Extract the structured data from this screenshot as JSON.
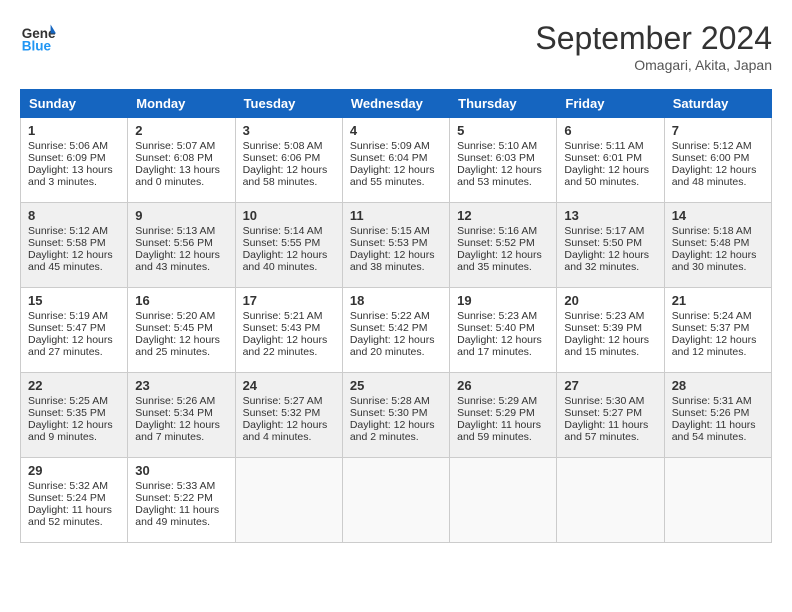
{
  "header": {
    "logo_line1": "General",
    "logo_line2": "Blue",
    "month": "September 2024",
    "location": "Omagari, Akita, Japan"
  },
  "weekdays": [
    "Sunday",
    "Monday",
    "Tuesday",
    "Wednesday",
    "Thursday",
    "Friday",
    "Saturday"
  ],
  "weeks": [
    [
      {
        "day": "1",
        "sunrise": "5:06 AM",
        "sunset": "6:09 PM",
        "daylight": "13 hours and 3 minutes."
      },
      {
        "day": "2",
        "sunrise": "5:07 AM",
        "sunset": "6:08 PM",
        "daylight": "13 hours and 0 minutes."
      },
      {
        "day": "3",
        "sunrise": "5:08 AM",
        "sunset": "6:06 PM",
        "daylight": "12 hours and 58 minutes."
      },
      {
        "day": "4",
        "sunrise": "5:09 AM",
        "sunset": "6:04 PM",
        "daylight": "12 hours and 55 minutes."
      },
      {
        "day": "5",
        "sunrise": "5:10 AM",
        "sunset": "6:03 PM",
        "daylight": "12 hours and 53 minutes."
      },
      {
        "day": "6",
        "sunrise": "5:11 AM",
        "sunset": "6:01 PM",
        "daylight": "12 hours and 50 minutes."
      },
      {
        "day": "7",
        "sunrise": "5:12 AM",
        "sunset": "6:00 PM",
        "daylight": "12 hours and 48 minutes."
      }
    ],
    [
      {
        "day": "8",
        "sunrise": "5:12 AM",
        "sunset": "5:58 PM",
        "daylight": "12 hours and 45 minutes."
      },
      {
        "day": "9",
        "sunrise": "5:13 AM",
        "sunset": "5:56 PM",
        "daylight": "12 hours and 43 minutes."
      },
      {
        "day": "10",
        "sunrise": "5:14 AM",
        "sunset": "5:55 PM",
        "daylight": "12 hours and 40 minutes."
      },
      {
        "day": "11",
        "sunrise": "5:15 AM",
        "sunset": "5:53 PM",
        "daylight": "12 hours and 38 minutes."
      },
      {
        "day": "12",
        "sunrise": "5:16 AM",
        "sunset": "5:52 PM",
        "daylight": "12 hours and 35 minutes."
      },
      {
        "day": "13",
        "sunrise": "5:17 AM",
        "sunset": "5:50 PM",
        "daylight": "12 hours and 32 minutes."
      },
      {
        "day": "14",
        "sunrise": "5:18 AM",
        "sunset": "5:48 PM",
        "daylight": "12 hours and 30 minutes."
      }
    ],
    [
      {
        "day": "15",
        "sunrise": "5:19 AM",
        "sunset": "5:47 PM",
        "daylight": "12 hours and 27 minutes."
      },
      {
        "day": "16",
        "sunrise": "5:20 AM",
        "sunset": "5:45 PM",
        "daylight": "12 hours and 25 minutes."
      },
      {
        "day": "17",
        "sunrise": "5:21 AM",
        "sunset": "5:43 PM",
        "daylight": "12 hours and 22 minutes."
      },
      {
        "day": "18",
        "sunrise": "5:22 AM",
        "sunset": "5:42 PM",
        "daylight": "12 hours and 20 minutes."
      },
      {
        "day": "19",
        "sunrise": "5:23 AM",
        "sunset": "5:40 PM",
        "daylight": "12 hours and 17 minutes."
      },
      {
        "day": "20",
        "sunrise": "5:23 AM",
        "sunset": "5:39 PM",
        "daylight": "12 hours and 15 minutes."
      },
      {
        "day": "21",
        "sunrise": "5:24 AM",
        "sunset": "5:37 PM",
        "daylight": "12 hours and 12 minutes."
      }
    ],
    [
      {
        "day": "22",
        "sunrise": "5:25 AM",
        "sunset": "5:35 PM",
        "daylight": "12 hours and 9 minutes."
      },
      {
        "day": "23",
        "sunrise": "5:26 AM",
        "sunset": "5:34 PM",
        "daylight": "12 hours and 7 minutes."
      },
      {
        "day": "24",
        "sunrise": "5:27 AM",
        "sunset": "5:32 PM",
        "daylight": "12 hours and 4 minutes."
      },
      {
        "day": "25",
        "sunrise": "5:28 AM",
        "sunset": "5:30 PM",
        "daylight": "12 hours and 2 minutes."
      },
      {
        "day": "26",
        "sunrise": "5:29 AM",
        "sunset": "5:29 PM",
        "daylight": "11 hours and 59 minutes."
      },
      {
        "day": "27",
        "sunrise": "5:30 AM",
        "sunset": "5:27 PM",
        "daylight": "11 hours and 57 minutes."
      },
      {
        "day": "28",
        "sunrise": "5:31 AM",
        "sunset": "5:26 PM",
        "daylight": "11 hours and 54 minutes."
      }
    ],
    [
      {
        "day": "29",
        "sunrise": "5:32 AM",
        "sunset": "5:24 PM",
        "daylight": "11 hours and 52 minutes."
      },
      {
        "day": "30",
        "sunrise": "5:33 AM",
        "sunset": "5:22 PM",
        "daylight": "11 hours and 49 minutes."
      },
      null,
      null,
      null,
      null,
      null
    ]
  ]
}
